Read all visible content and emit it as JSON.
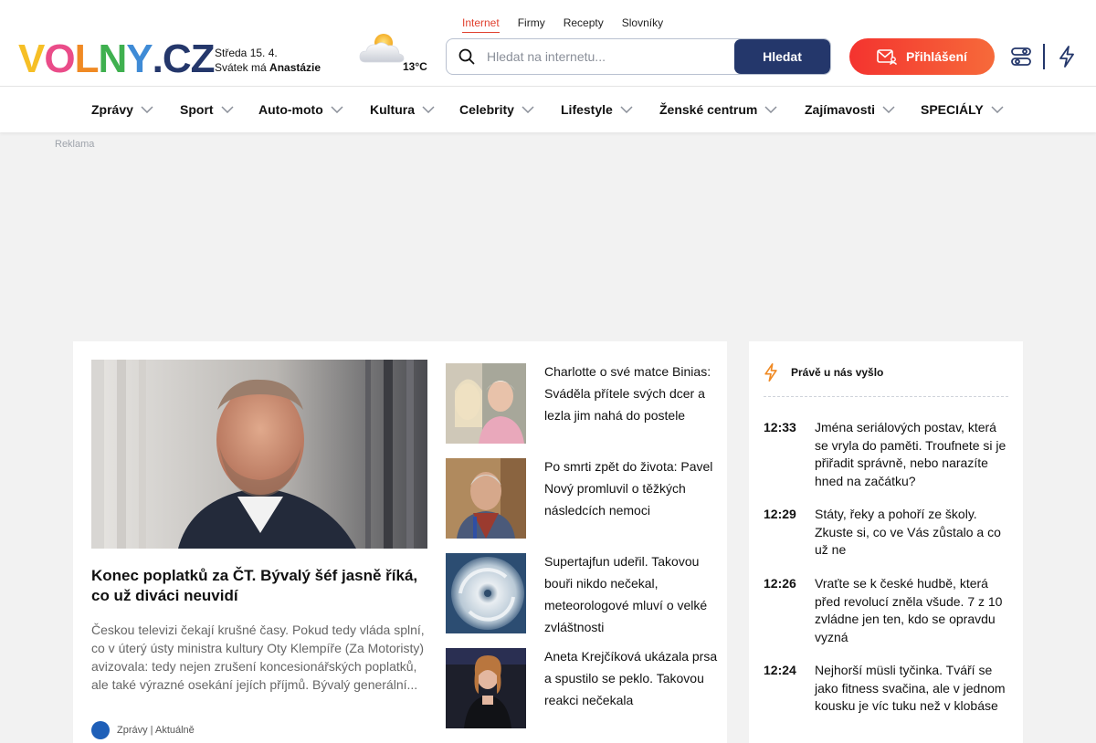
{
  "header": {
    "logo": {
      "letters": [
        "V",
        "O",
        "L",
        "N",
        "Y",
        ".",
        "C",
        "Z"
      ],
      "colors": [
        "#f6bf26",
        "#ea4c89",
        "#f08a24",
        "#3fb04f",
        "#3f8bd6",
        "#24376b",
        "#24376b",
        "#24376b"
      ]
    },
    "date": {
      "day_line": "Středa 15. 4.",
      "nameday_prefix": "Svátek má",
      "nameday_name": "Anastázie"
    },
    "weather": {
      "icon": "partly-cloudy-icon",
      "temperature": "13°C"
    },
    "search_tabs": [
      {
        "label": "Internet",
        "active": true
      },
      {
        "label": "Firmy",
        "active": false
      },
      {
        "label": "Recepty",
        "active": false
      },
      {
        "label": "Slovníky",
        "active": false
      }
    ],
    "search": {
      "placeholder": "Hledat na internetu...",
      "value": "",
      "button_label": "Hledat"
    },
    "login_label": "Přihlášení",
    "icons": [
      "settings-sliders-icon",
      "lightning-icon"
    ]
  },
  "nav": {
    "items": [
      {
        "label": "Zprávy"
      },
      {
        "label": "Sport"
      },
      {
        "label": "Auto-moto"
      },
      {
        "label": "Kultura"
      },
      {
        "label": "Celebrity"
      },
      {
        "label": "Lifestyle"
      },
      {
        "label": "Ženské centrum"
      },
      {
        "label": "Zajímavosti"
      },
      {
        "label": "SPECIÁLY"
      }
    ]
  },
  "ad": {
    "label": "Reklama"
  },
  "lead_article": {
    "title": "Konec poplatků za ČT. Bývalý šéf jasně říká, co už diváci neuvidí",
    "perex": "Českou televizi čekají krušné časy. Pokud tedy vláda splní, co v úterý ústy ministra kultury Oty Klempíře (Za Motoristy) avizovala: tedy nejen zrušení koncesionářských poplatků, ale také výrazné osekání jejích příjmů. Bývalý generální...",
    "source": "Zprávy | Aktuálně"
  },
  "side_articles": [
    {
      "title": "Charlotte o své matce Binias: Sváděla přítele svých dcer a lezla jim nahá do postele"
    },
    {
      "title": "Po smrti zpět do života: Pavel Nový promluvil o těžkých následcích nemoci"
    },
    {
      "title": "Supertajfun udeřil. Takovou bouři nikdo nečekal, meteorologové mluví o velké zvláštnosti"
    },
    {
      "title": "Aneta Krejčíková ukázala prsa a spustilo se peklo. Takovou reakci nečekala"
    }
  ],
  "latest": {
    "heading": "Právě u nás vyšlo",
    "items": [
      {
        "time": "12:33",
        "title": "Jména seriálových postav, která se vryla do paměti. Troufnete si je přiřadit správně, nebo narazíte hned na začátku?"
      },
      {
        "time": "12:29",
        "title": "Státy, řeky a pohoří ze školy. Zkuste si, co ve Vás zůstalo a co už ne"
      },
      {
        "time": "12:26",
        "title": "Vraťte se k české hudbě, která před revolucí zněla všude. 7 z 10 zvládne jen ten, kdo se opravdu vyzná"
      },
      {
        "time": "12:24",
        "title": "Nejhorší müsli tyčinka. Tváří se jako fitness svačina, ale v jednom kousku je víc tuku než v klobáse"
      }
    ]
  },
  "colors": {
    "accent_red": "#e0412f",
    "navy": "#24376b",
    "login_gradient_start": "#f4332f",
    "login_gradient_end": "#f66a3a"
  }
}
